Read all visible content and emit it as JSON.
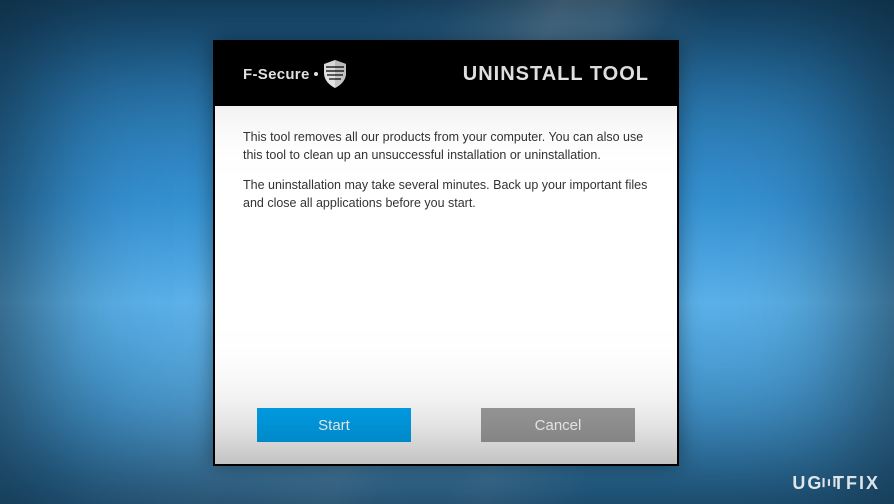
{
  "brand": {
    "name": "F-Secure"
  },
  "header": {
    "title": "UNINSTALL TOOL"
  },
  "body": {
    "para1": "This tool removes all our products from your computer. You can also use this tool to clean up an unsuccessful installation or uninstallation.",
    "para2": "The uninstallation may take several minutes. Back up your important files and close all applications before you start."
  },
  "buttons": {
    "start": "Start",
    "cancel": "Cancel"
  },
  "watermark": {
    "text": "UGETFIX"
  }
}
